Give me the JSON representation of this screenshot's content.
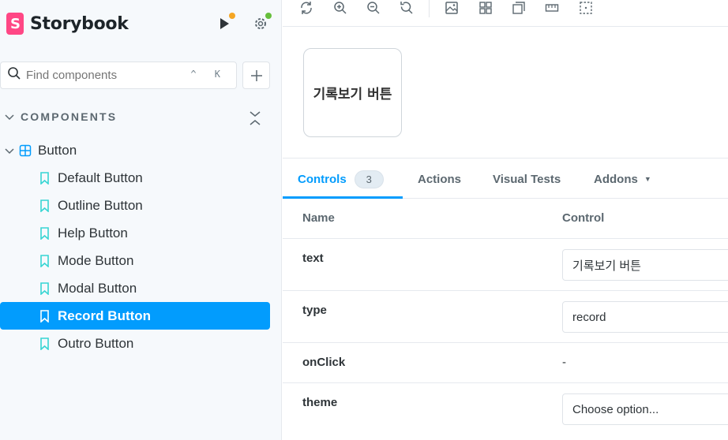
{
  "brand": {
    "title": "Storybook"
  },
  "search": {
    "placeholder": "Find components",
    "shortcut": "^ K"
  },
  "sidebar": {
    "section": "COMPONENTS",
    "group": "Button",
    "stories": [
      "Default Button",
      "Outline Button",
      "Help Button",
      "Mode Button",
      "Modal Button",
      "Record Button",
      "Outro Button"
    ],
    "selected": "Record Button"
  },
  "toolbar": {
    "icons": [
      "reload-icon",
      "zoom-in-icon",
      "zoom-out-icon",
      "zoom-reset-icon",
      "background-icon",
      "grid-icon",
      "outline-icon",
      "measure-icon",
      "viewport-icon"
    ]
  },
  "preview": {
    "button_text": "기록보기 버튼"
  },
  "addons": {
    "tabs": {
      "controls": "Controls",
      "controls_count": "3",
      "actions": "Actions",
      "visual_tests": "Visual Tests",
      "addons": "Addons"
    },
    "table": {
      "header_name": "Name",
      "header_control": "Control",
      "rows": [
        {
          "name": "text",
          "value": "기록보기 버튼"
        },
        {
          "name": "type",
          "value": "record"
        },
        {
          "name": "onClick",
          "value": "-"
        },
        {
          "name": "theme",
          "value": "Choose option..."
        }
      ]
    }
  },
  "colors": {
    "accent": "#029cfd",
    "brand": "#ff4785",
    "story_icon": "#37d5d3",
    "component_icon": "#029cfd"
  }
}
